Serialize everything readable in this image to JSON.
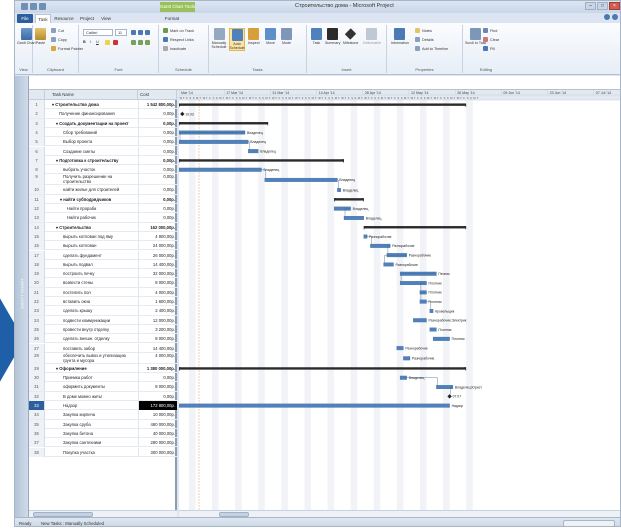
{
  "window": {
    "title": "Строительство дома - Microsoft Project",
    "contextual_tab": "Gantt Chart Tools"
  },
  "ribbon_tabs": [
    "File",
    "Task",
    "Resource",
    "Project",
    "View",
    "Format"
  ],
  "ribbon": {
    "groups": [
      "View",
      "Clipboard",
      "Font",
      "Schedule",
      "Tasks",
      "Insert",
      "Properties",
      "Editing"
    ],
    "gantt_chart_label": "Gantt Chart",
    "paste_label": "Paste",
    "cut_label": "Cut",
    "copy_label": "Copy",
    "format_painter_label": "Format Painter",
    "font_name": "Calibri",
    "font_size": "11",
    "mark_on_track": "Mark on Track",
    "respect_links": "Respect Links",
    "inactivate": "Inactivate",
    "manually_schedule": "Manually Schedule",
    "auto_schedule": "Auto Schedule",
    "inspect": "Inspect",
    "move": "Move",
    "mode": "Mode",
    "task": "Task",
    "summary": "Summary",
    "milestone": "Milestone",
    "deliverable": "Deliverable",
    "information": "Information",
    "notes": "Notes",
    "details": "Details",
    "add_to_timeline": "Add to Timeline",
    "scroll_to_task": "Scroll to Task",
    "find": "Find",
    "clear": "Clear",
    "fill": "Fill"
  },
  "table": {
    "columns": [
      "Task Name",
      "Cost"
    ],
    "rows": [
      {
        "id": "1",
        "name": "Строительство дома",
        "cost": "1 542 800,00р.",
        "summary": true,
        "indent": 0
      },
      {
        "id": "2",
        "name": "Получение финансирования",
        "cost": "0,00р.",
        "summary": false,
        "indent": 1
      },
      {
        "id": "3",
        "name": "Создать документации на проект",
        "cost": "0,00р.",
        "summary": true,
        "indent": 1
      },
      {
        "id": "4",
        "name": "Сбор требований",
        "cost": "0,00р.",
        "summary": false,
        "indent": 2
      },
      {
        "id": "5",
        "name": "Выбор проекта",
        "cost": "0,00р.",
        "summary": false,
        "indent": 2
      },
      {
        "id": "6",
        "name": "Создание сметы",
        "cost": "0,00р.",
        "summary": false,
        "indent": 2
      },
      {
        "id": "7",
        "name": "Подготовка к строительству",
        "cost": "0,00р.",
        "summary": true,
        "indent": 1
      },
      {
        "id": "8",
        "name": "выбрать участок",
        "cost": "0,00р.",
        "summary": false,
        "indent": 2
      },
      {
        "id": "9",
        "name": "Получить разрешение на строительство",
        "cost": "0,00р.",
        "summary": false,
        "indent": 2,
        "tall": true
      },
      {
        "id": "10",
        "name": "найти жилье для строителей",
        "cost": "0,00р.",
        "summary": false,
        "indent": 2
      },
      {
        "id": "11",
        "name": "найти субподрядчиков",
        "cost": "0,00р.",
        "summary": true,
        "indent": 2
      },
      {
        "id": "12",
        "name": "Найти прораба",
        "cost": "0,00р.",
        "summary": false,
        "indent": 3
      },
      {
        "id": "13",
        "name": "Найти рабочих",
        "cost": "0,00р.",
        "summary": false,
        "indent": 3
      },
      {
        "id": "14",
        "name": "Строительство",
        "cost": "162 000,00р.",
        "summary": true,
        "indent": 1
      },
      {
        "id": "15",
        "name": "вырыть котлован под яму",
        "cost": "4 800,00р.",
        "summary": false,
        "indent": 2
      },
      {
        "id": "16",
        "name": "вырыть котлован",
        "cost": "24 000,00р.",
        "summary": false,
        "indent": 2
      },
      {
        "id": "17",
        "name": "сделать фундамент",
        "cost": "26 000,00р.",
        "summary": false,
        "indent": 2
      },
      {
        "id": "18",
        "name": "вырыть подвал",
        "cost": "14 400,00р.",
        "summary": false,
        "indent": 2
      },
      {
        "id": "19",
        "name": "построить печку",
        "cost": "32 000,00р.",
        "summary": false,
        "indent": 2
      },
      {
        "id": "20",
        "name": "возвести стены",
        "cost": "8 000,00р.",
        "summary": false,
        "indent": 2
      },
      {
        "id": "21",
        "name": "постелить пол",
        "cost": "4 000,00р.",
        "summary": false,
        "indent": 2
      },
      {
        "id": "22",
        "name": "вставить окна",
        "cost": "1 600,00р.",
        "summary": false,
        "indent": 2
      },
      {
        "id": "23",
        "name": "сделать крышу",
        "cost": "2 400,00р.",
        "summary": false,
        "indent": 2
      },
      {
        "id": "24",
        "name": "подвести коммуникации",
        "cost": "12 000,00р.",
        "summary": false,
        "indent": 2
      },
      {
        "id": "25",
        "name": "провести внутр отделку",
        "cost": "3 200,00р.",
        "summary": false,
        "indent": 2
      },
      {
        "id": "26",
        "name": "сделать внешн. отделку",
        "cost": "8 000,00р.",
        "summary": false,
        "indent": 2
      },
      {
        "id": "27",
        "name": "поставить забор",
        "cost": "14 400,00р.",
        "summary": false,
        "indent": 2
      },
      {
        "id": "28",
        "name": "обеспечить вывоз и утилизацию грунта и мусора",
        "cost": "4 000,00р.",
        "summary": false,
        "indent": 2,
        "tall": true
      },
      {
        "id": "29",
        "name": "Оформление",
        "cost": "1 380 000,00р.",
        "summary": true,
        "indent": 1
      },
      {
        "id": "30",
        "name": "Приемка работ",
        "cost": "0,00р.",
        "summary": false,
        "indent": 2
      },
      {
        "id": "31",
        "name": "оформить документы",
        "cost": "8 000,00р.",
        "summary": false,
        "indent": 2
      },
      {
        "id": "32",
        "name": "В доме можно жить!",
        "cost": "0,00р.",
        "summary": false,
        "indent": 2
      },
      {
        "id": "33",
        "name": "Надзор",
        "cost": "172 800,00р.",
        "summary": false,
        "indent": 2,
        "selected": true
      },
      {
        "id": "34",
        "name": "Закупка кирпича",
        "cost": "10 000,00р.",
        "summary": false,
        "indent": 2
      },
      {
        "id": "35",
        "name": "Закупка сруба",
        "cost": "480 000,00р.",
        "summary": false,
        "indent": 2
      },
      {
        "id": "36",
        "name": "Закупка бетона",
        "cost": "40 000,00р.",
        "summary": false,
        "indent": 2
      },
      {
        "id": "37",
        "name": "Закупка сантехники",
        "cost": "280 000,00р.",
        "summary": false,
        "indent": 2
      },
      {
        "id": "38",
        "name": "Покупка участка",
        "cost": "300 000,00р.",
        "summary": false,
        "indent": 2
      }
    ]
  },
  "timescale": {
    "weeks": [
      "Mar '14",
      "17 Mar '14",
      "31 Mar '14",
      "14 Apr '14",
      "28 Apr '14",
      "12 May '14",
      "26 May '14",
      "09 Jun '14",
      "23 Jun '14",
      "07 Jul '14",
      "21 Jul '14",
      "04 Aug '14",
      "18 Aug '14",
      "01 Sep '14"
    ],
    "day_letters": "WTFSSMTWTFSSMTWTFSSMTWTFSSMTWTFSSMTWTFSSMTWTFSSMTWTFSSMTWTFSSMTWTFSSMTWTFSSMTWTFSSMTWTFSSMT"
  },
  "gantt_labels": {
    "milestone_2": "19.03",
    "r4": "Владелец",
    "r5": "Владелец",
    "r6": "Владелец",
    "r8": "Владелец",
    "r9": "Владелец",
    "r10": "Владелец",
    "r12": "Владелец",
    "r13": "Владелец",
    "r15": "Разнорабочие",
    "r16": "Разнорабочие",
    "r17": "Разнорабочие",
    "r18": "Разнорабочие",
    "r19": "Печник",
    "r20": "Плотник",
    "r21": "Плотник",
    "r22": "Плотник",
    "r23": "Кровельщик",
    "r24": "Разнорабочие;Электрик",
    "r25": "Плотник",
    "r26": "Плотник",
    "r27": "Разнорабочие",
    "r28": "Разнорабочие",
    "r30": "Владелец",
    "r31": "Владелец;Юрист",
    "r32": "07.07",
    "r33": "Надзор"
  },
  "status": {
    "ready": "Ready",
    "new_tasks": "New Tasks : Manually Scheduled"
  },
  "colors": {
    "bar": "#4f81bd",
    "summary_bar": "#2b2b2b",
    "ribbon_accent": "#2d5f9e",
    "contextual_tab": "#98c15a",
    "arrow": "#1f5fa8"
  },
  "icons": [
    "arrow-right-icon",
    "paste-icon",
    "gantt-chart-icon",
    "task-icon",
    "summary-icon",
    "milestone-icon",
    "find-icon",
    "clear-icon",
    "fill-icon",
    "information-icon"
  ]
}
